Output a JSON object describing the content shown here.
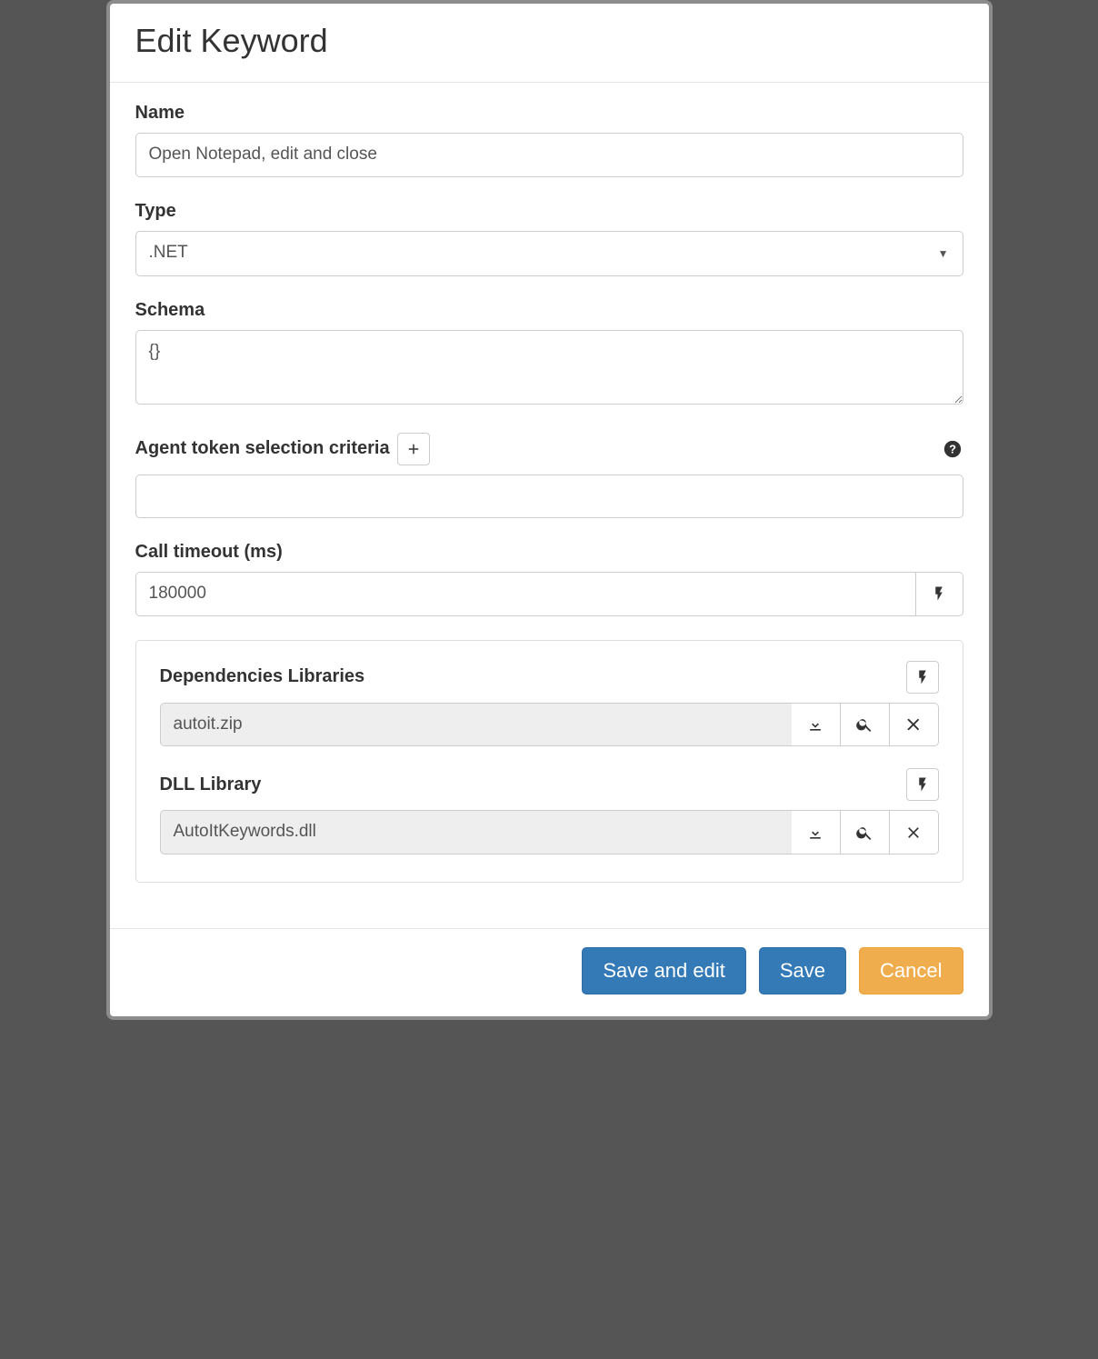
{
  "modal": {
    "title": "Edit Keyword"
  },
  "form": {
    "name_label": "Name",
    "name_value": "Open Notepad, edit and close",
    "type_label": "Type",
    "type_value": ".NET",
    "schema_label": "Schema",
    "schema_value": "{}",
    "agent_criteria_label": "Agent token selection criteria",
    "agent_criteria_value": "",
    "call_timeout_label": "Call timeout (ms)",
    "call_timeout_value": "180000"
  },
  "panel": {
    "dependencies_label": "Dependencies Libraries",
    "dependencies_file": "autoit.zip",
    "dll_label": "DLL Library",
    "dll_file": "AutoItKeywords.dll"
  },
  "footer": {
    "save_edit": "Save and edit",
    "save": "Save",
    "cancel": "Cancel"
  }
}
